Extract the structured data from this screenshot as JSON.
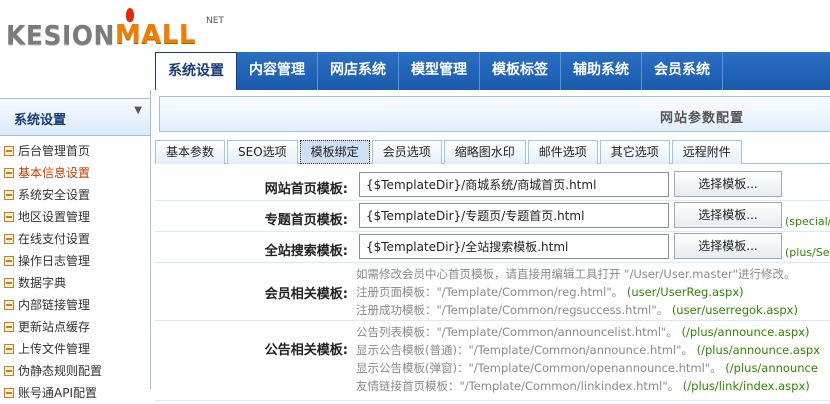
{
  "brand": {
    "logo_left": "KESION",
    "logo_right": "MALL",
    "logo_net": "NET"
  },
  "topnav": [
    {
      "label": "系统设置",
      "active": true
    },
    {
      "label": "内容管理"
    },
    {
      "label": "网店系统"
    },
    {
      "label": "模型管理"
    },
    {
      "label": "模板标签"
    },
    {
      "label": "辅助系统"
    },
    {
      "label": "会员系统"
    }
  ],
  "sidebar": {
    "title": "系统设置",
    "items": [
      {
        "label": "后台管理首页"
      },
      {
        "label": "基本信息设置",
        "active": true
      },
      {
        "label": "系统安全设置"
      },
      {
        "label": "地区设置管理"
      },
      {
        "label": "在线支付设置"
      },
      {
        "label": "操作日志管理"
      },
      {
        "label": "数据字典"
      },
      {
        "label": "内部链接管理"
      },
      {
        "label": "更新站点缓存"
      },
      {
        "label": "上传文件管理"
      },
      {
        "label": "伪静态规则配置"
      },
      {
        "label": "账号通API配置"
      }
    ]
  },
  "main": {
    "title": "网站参数配置",
    "subtabs": [
      {
        "label": "基本参数"
      },
      {
        "label": "SEO选项"
      },
      {
        "label": "模板绑定",
        "active": true
      },
      {
        "label": "会员选项"
      },
      {
        "label": "缩略图水印"
      },
      {
        "label": "邮件选项"
      },
      {
        "label": "其它选项"
      },
      {
        "label": "远程附件"
      }
    ],
    "choose_button": "选择模板...",
    "rows": [
      {
        "label": "网站首页模板:",
        "value": "{$TemplateDir}/商城系统/商城首页.html",
        "path": ""
      },
      {
        "label": "专题首页模板:",
        "value": "{$TemplateDir}/专题页/专题首页.html",
        "path": "(special/in"
      },
      {
        "label": "全站搜索模板:",
        "value": "{$TemplateDir}/全站搜索模板.html",
        "path": "(plus/Sear"
      }
    ],
    "member": {
      "label": "会员相关模板:",
      "lines": [
        {
          "text": "如需修改会员中心首页模板，请直接用编辑工具打开 \"/User/User.master\"进行修改。",
          "g": ""
        },
        {
          "text": "注册页面模板：\"/Template/Common/reg.html\"。",
          "g": "(user/UserReg.aspx)"
        },
        {
          "text": "注册成功模板：\"/Template/Common/regsuccess.html\"。",
          "g": "(user/userregok.aspx)"
        }
      ]
    },
    "announce": {
      "label": "公告相关模板:",
      "lines": [
        {
          "text": "公告列表模板：\"/Template/Common/announcelist.html\"。",
          "g": "(/plus/announce.aspx)"
        },
        {
          "text": "显示公告模板(普通)：\"/Template/Common/announce.html\"。",
          "g": "(/plus/announce.aspx"
        },
        {
          "text": "显示公告模板(弹窗)：\"/Template/Common/openannounce.html\"。",
          "g": "(/plus/announce"
        },
        {
          "text": "友情链接首页模板：\"/Template/Common/linkindex.html\"。",
          "g": "(/plus/link/index.aspx)"
        }
      ]
    }
  },
  "colors": {
    "nav_blue": "#1a5aac",
    "accent_orange": "#f07d00",
    "active_red": "#c83c00",
    "path_green": "#2d8a00"
  }
}
